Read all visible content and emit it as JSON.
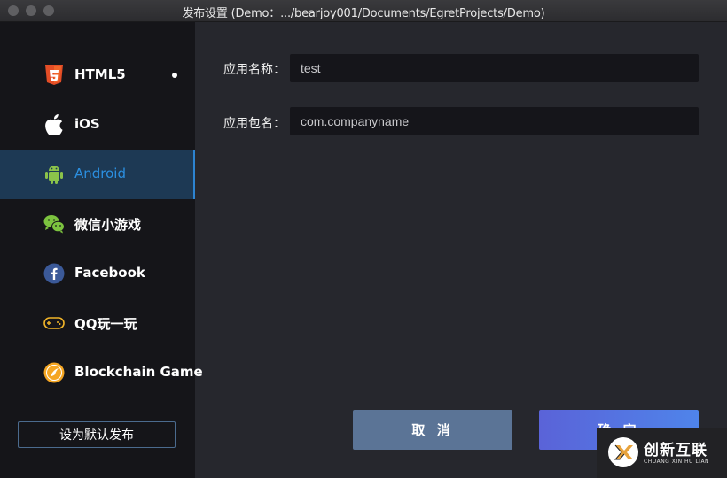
{
  "window": {
    "title": "发布设置 (Demo：.../bearjoy001/Documents/EgretProjects/Demo)"
  },
  "sidebar": {
    "items": [
      {
        "label": "HTML5",
        "icon": "html5-icon"
      },
      {
        "label": "iOS",
        "icon": "apple-icon"
      },
      {
        "label": "Android",
        "icon": "android-icon"
      },
      {
        "label": "微信小游戏",
        "icon": "wechat-icon"
      },
      {
        "label": "Facebook",
        "icon": "facebook-icon"
      },
      {
        "label": "QQ玩一玩",
        "icon": "gamepad-icon"
      },
      {
        "label": "Blockchain Game",
        "icon": "blockchain-icon"
      }
    ],
    "active_item": "Android",
    "default_button_label": "设为默认发布"
  },
  "form": {
    "app_name_label": "应用名称：",
    "app_name_value": "test",
    "package_label": "应用包名：",
    "package_value": "com.companyname"
  },
  "actions": {
    "cancel_label": "取 消",
    "confirm_label": "确 定"
  },
  "watermark": {
    "text": "创新互联",
    "subtext": "CHUANG XIN HU LIAN"
  },
  "colors": {
    "active_bg": "#1d3954",
    "active_text": "#2b8fe0",
    "cancel": "#5b7496",
    "confirm": "#5a6ee0"
  }
}
